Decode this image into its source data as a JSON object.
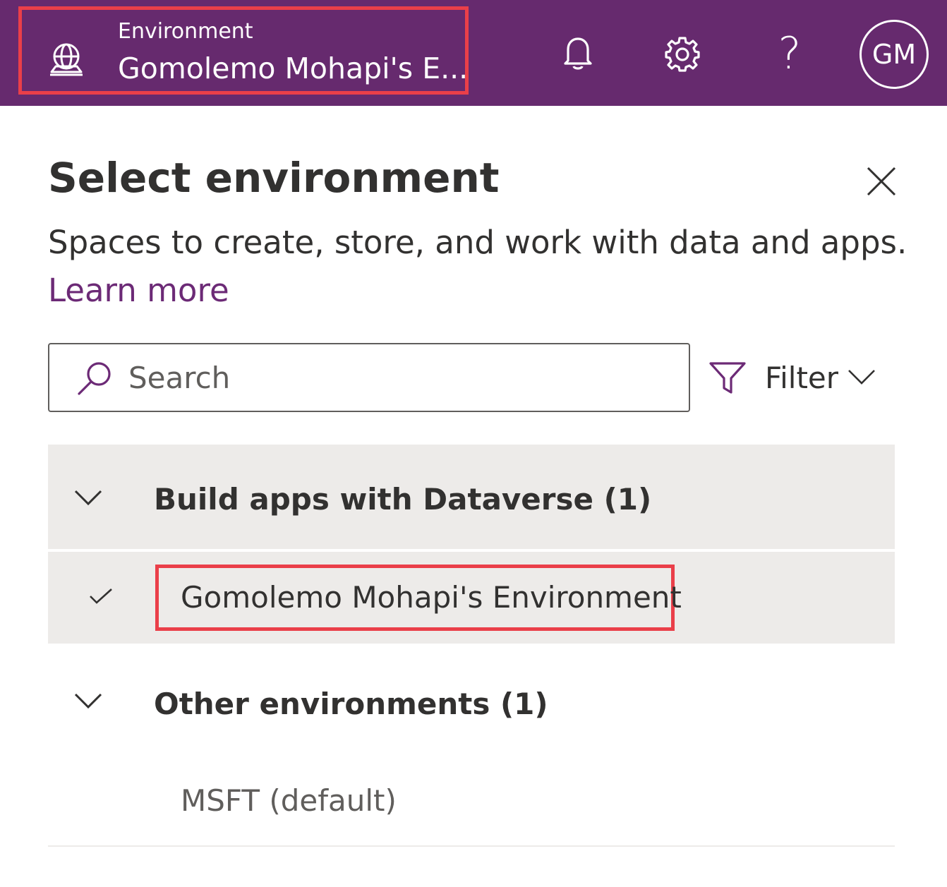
{
  "header": {
    "environment_label": "Environment",
    "environment_name": "Gomolemo Mohapi's E...",
    "avatar_initials": "GM",
    "help_glyph": "?",
    "icons": [
      "globe-icon",
      "bell-icon",
      "gear-icon",
      "help-icon"
    ],
    "background_color": "#662a6e"
  },
  "panel": {
    "title": "Select environment",
    "description": "Spaces to create, store, and work with data and apps.",
    "learn_more": "Learn more",
    "search": {
      "placeholder": "Search",
      "value": ""
    },
    "filter_label": "Filter",
    "groups": [
      {
        "title": "Build apps with Dataverse (1)",
        "items": [
          {
            "name": "Gomolemo Mohapi's Environment",
            "selected": true
          }
        ]
      },
      {
        "title": "Other environments (1)",
        "items": [
          {
            "name": "MSFT (default)",
            "selected": false
          }
        ]
      }
    ]
  },
  "colors": {
    "accent": "#662a6e",
    "link": "#6c2a76",
    "highlight_box": "#ea3f49",
    "selected_row": "#edebe9"
  }
}
